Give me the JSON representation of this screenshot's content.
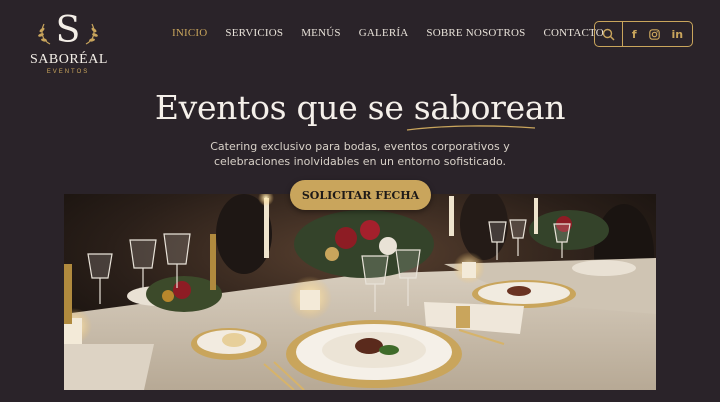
{
  "brand": {
    "name": "SABORÉAL",
    "tagline": "EVENTOS",
    "monogram": "S"
  },
  "nav": {
    "items": [
      {
        "label": "INICIO",
        "active": true
      },
      {
        "label": "SERVICIOS",
        "active": false
      },
      {
        "label": "MENÚS",
        "active": false
      },
      {
        "label": "GALERÍA",
        "active": false
      },
      {
        "label": "SOBRE NOSOTROS",
        "active": false
      },
      {
        "label": "CONTACTO",
        "active": false
      }
    ]
  },
  "tools": {
    "search_icon": "search-icon",
    "facebook": "f",
    "instagram_icon": "instagram-icon",
    "linkedin": "in"
  },
  "hero": {
    "title": "Eventos que se saborean",
    "subtitle_line1": "Catering exclusivo para bodas, eventos corporativos y",
    "subtitle_line2": "celebraciones inolvidables en un entorno sofisticado.",
    "cta_label": "SOLICITAR FECHA"
  },
  "colors": {
    "background": "#2a2329",
    "accent_gold": "#c9a55c",
    "text_light": "#f2ece4"
  }
}
